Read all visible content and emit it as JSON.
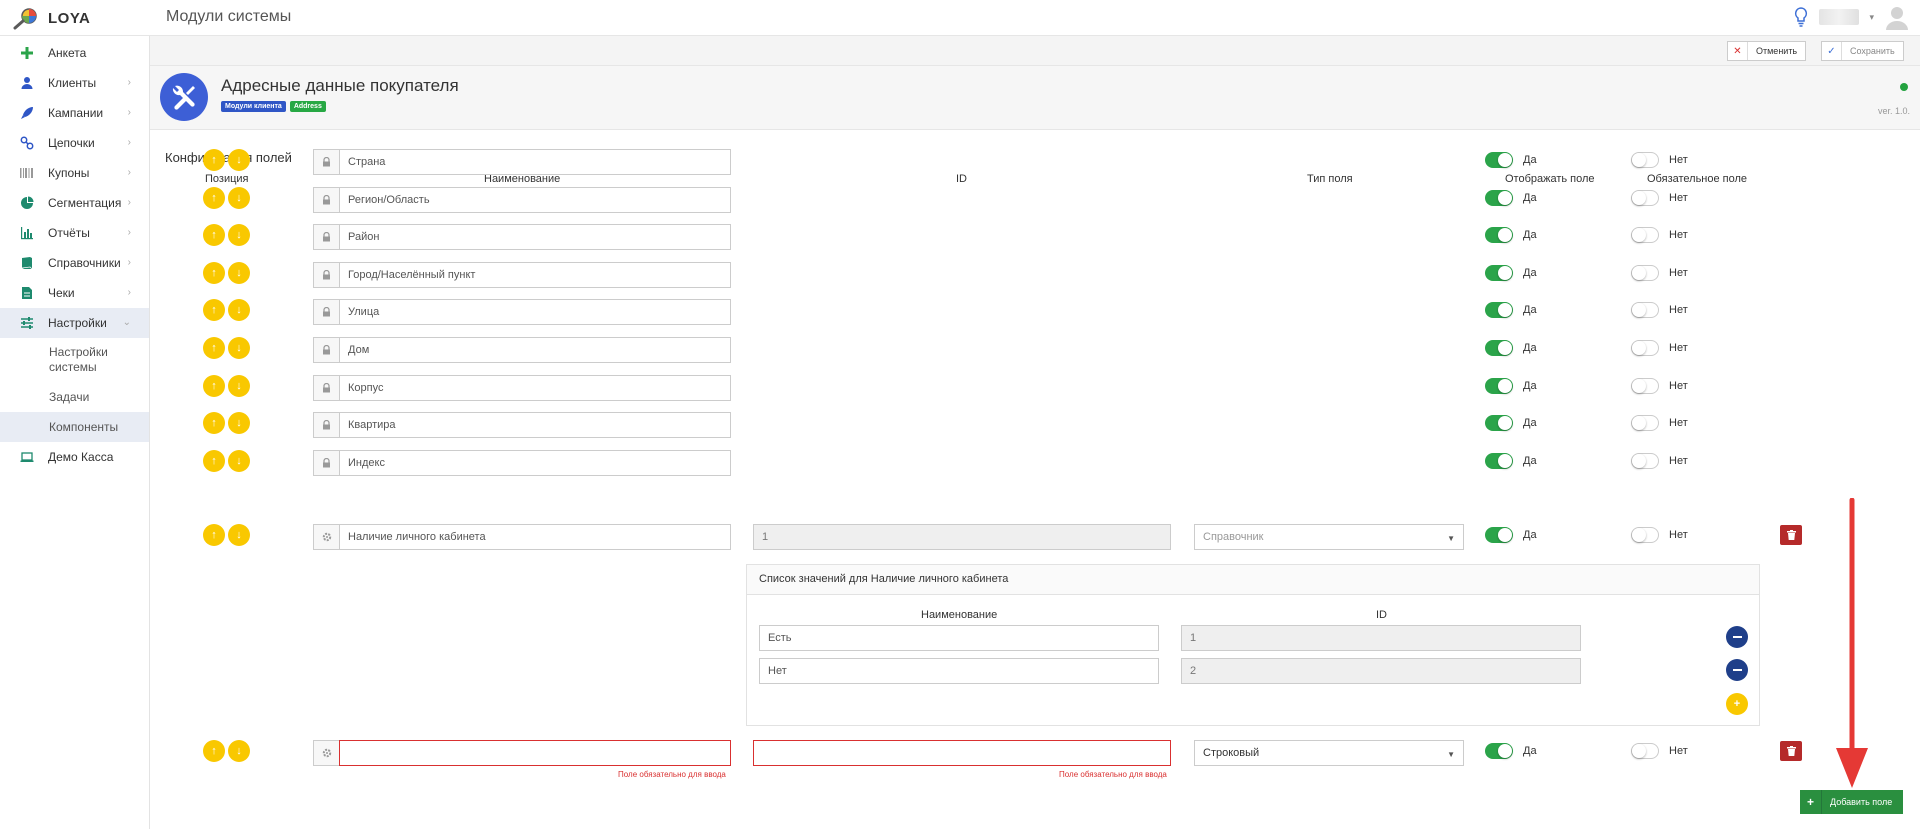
{
  "app": {
    "brand": "LOYA",
    "page_title": "Модули системы"
  },
  "sidebar": {
    "items": [
      {
        "label": "Анкета",
        "icon": "plus-icon",
        "chevron": false
      },
      {
        "label": "Клиенты",
        "icon": "user-icon",
        "chevron": true
      },
      {
        "label": "Кампании",
        "icon": "rocket-icon",
        "chevron": true
      },
      {
        "label": "Цепочки",
        "icon": "chain-icon",
        "chevron": true
      },
      {
        "label": "Купоны",
        "icon": "barcode-icon",
        "chevron": true
      },
      {
        "label": "Сегментация",
        "icon": "pie-icon",
        "chevron": true
      },
      {
        "label": "Отчёты",
        "icon": "bar-chart-icon",
        "chevron": true
      },
      {
        "label": "Справочники",
        "icon": "book-icon",
        "chevron": true
      },
      {
        "label": "Чеки",
        "icon": "receipt-icon",
        "chevron": true
      },
      {
        "label": "Настройки",
        "icon": "sliders-icon",
        "chevron": true,
        "active": true
      }
    ],
    "subitems": [
      {
        "label": "Настройки системы"
      },
      {
        "label": "Задачи"
      },
      {
        "label": "Компоненты",
        "active": true
      }
    ],
    "last_item": {
      "label": "Демо Касса",
      "icon": "laptop-icon"
    }
  },
  "toolbar": {
    "cancel_label": "Отменить",
    "save_label": "Сохранить"
  },
  "module": {
    "title": "Адресные данные покупателя",
    "badges": [
      {
        "label": "Модули клиента",
        "color": "#2f56c6"
      },
      {
        "label": "Address",
        "color": "#27a844"
      }
    ],
    "version": "ver. 1.0."
  },
  "config": {
    "title": "Конфигурация полей",
    "columns": {
      "position": "Позиция",
      "name": "Наименование",
      "id": "ID",
      "type": "Тип поля",
      "display": "Отображать поле",
      "required": "Обязательное поле"
    },
    "yes": "Да",
    "no": "Нет",
    "fields": [
      {
        "name": "Страна"
      },
      {
        "name": "Регион/Область"
      },
      {
        "name": "Район"
      },
      {
        "name": "Город/Населённый пункт"
      },
      {
        "name": "Улица"
      },
      {
        "name": "Дом"
      },
      {
        "name": "Корпус"
      },
      {
        "name": "Квартира"
      },
      {
        "name": "Индекс"
      }
    ],
    "custom_field": {
      "name": "Наличие личного кабинета",
      "id": "1",
      "type": "Справочник"
    },
    "values_panel": {
      "title": "Список значений для Наличие личного кабинета",
      "col_name": "Наименование",
      "col_id": "ID",
      "values": [
        {
          "name": "Есть",
          "id": "1"
        },
        {
          "name": "Нет",
          "id": "2"
        }
      ]
    },
    "new_field": {
      "name": "",
      "id": "",
      "type": "Строковый"
    },
    "required_error": "Поле обязательно для ввода",
    "add_field_label": "Добавить поле"
  },
  "colors": {
    "accent_yellow": "#f9c800",
    "toggle_on": "#2ba44a",
    "danger": "#b52a2a",
    "primary": "#3d5fd6",
    "add_green": "#2a8f3f"
  }
}
